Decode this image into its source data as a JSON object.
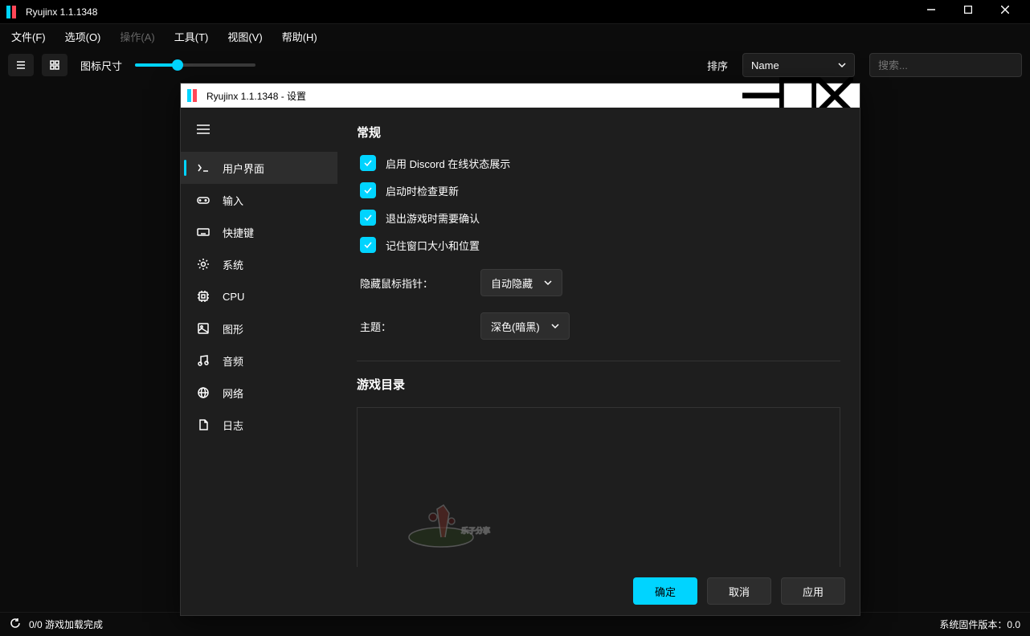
{
  "main": {
    "title": "Ryujinx 1.1.1348",
    "menu": {
      "file": "文件(F)",
      "options": "选项(O)",
      "action": "操作(A)",
      "tools": "工具(T)",
      "view": "视图(V)",
      "help": "帮助(H)"
    },
    "toolbar": {
      "icon_size_label": "图标尺寸",
      "sort_label": "排序",
      "sort_value": "Name",
      "search_placeholder": "搜索..."
    },
    "status": {
      "left": "0/0 游戏加载完成",
      "right": "系统固件版本：0.0"
    }
  },
  "settings": {
    "title": "Ryujinx 1.1.1348 - 设置",
    "nav": {
      "ui": "用户界面",
      "input": "输入",
      "hotkeys": "快捷键",
      "system": "系统",
      "cpu": "CPU",
      "graphics": "图形",
      "audio": "音频",
      "network": "网络",
      "logging": "日志"
    },
    "general": {
      "heading": "常规",
      "discord": "启用 Discord 在线状态展示",
      "check_update": "启动时检查更新",
      "confirm_exit": "退出游戏时需要确认",
      "remember_window": "记住窗口大小和位置",
      "cursor_label": "隐藏鼠标指针：",
      "cursor_value": "自动隐藏",
      "theme_label": "主题：",
      "theme_value": "深色(暗黑)"
    },
    "gamedirs": {
      "heading": "游戏目录"
    },
    "footer": {
      "ok": "确定",
      "cancel": "取消",
      "apply": "应用"
    }
  }
}
